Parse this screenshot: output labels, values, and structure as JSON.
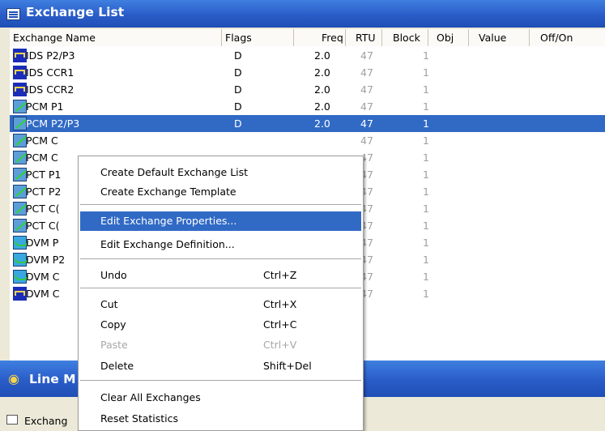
{
  "title": "Exchange List",
  "columns": [
    "Exchange Name",
    "Flags",
    "Freq",
    "RTU",
    "Block",
    "Obj",
    "Value",
    "Off/On"
  ],
  "rows": [
    {
      "icon": "ids-icon",
      "name": "IDS P2/P3",
      "flags": "D",
      "freq": "2.0",
      "rtu": "47",
      "block": "1"
    },
    {
      "icon": "ids-icon",
      "name": "IDS CCR1",
      "flags": "D",
      "freq": "2.0",
      "rtu": "47",
      "block": "1"
    },
    {
      "icon": "ids-icon",
      "name": "IDS CCR2",
      "flags": "D",
      "freq": "2.0",
      "rtu": "47",
      "block": "1"
    },
    {
      "icon": "pcm-icon",
      "name": "PCM P1",
      "flags": "D",
      "freq": "2.0",
      "rtu": "47",
      "block": "1"
    },
    {
      "icon": "pcm-icon",
      "name": "PCM P2/P3",
      "flags": "D",
      "freq": "2.0",
      "rtu": "47",
      "block": "1",
      "selected": true
    },
    {
      "icon": "pcm-icon",
      "name": "PCM C",
      "flags": "",
      "freq": "",
      "rtu": "47",
      "block": "1"
    },
    {
      "icon": "pcm-icon",
      "name": "PCM C",
      "flags": "",
      "freq": "",
      "rtu": "47",
      "block": "1"
    },
    {
      "icon": "pcm-icon",
      "name": "PCT P1",
      "flags": "",
      "freq": "",
      "rtu": "47",
      "block": "1"
    },
    {
      "icon": "pcm-icon",
      "name": "PCT P2",
      "flags": "",
      "freq": "",
      "rtu": "47",
      "block": "1"
    },
    {
      "icon": "pcm-icon",
      "name": "PCT C(",
      "flags": "",
      "freq": "",
      "rtu": "47",
      "block": "1"
    },
    {
      "icon": "pcm-icon",
      "name": "PCT C(",
      "flags": "",
      "freq": "",
      "rtu": "47",
      "block": "1"
    },
    {
      "icon": "dvm-icon",
      "name": "DVM P",
      "flags": "",
      "freq": "",
      "rtu": "47",
      "block": "1"
    },
    {
      "icon": "dvm-icon",
      "name": "DVM P2",
      "flags": "",
      "freq": "",
      "rtu": "47",
      "block": "1"
    },
    {
      "icon": "dvm-icon",
      "name": "DVM C",
      "flags": "",
      "freq": "",
      "rtu": "47",
      "block": "1"
    },
    {
      "icon": "ids-icon",
      "name": "DVM C",
      "flags": "",
      "freq": "",
      "rtu": "47",
      "block": "1"
    }
  ],
  "line_panel": {
    "title": "Line M"
  },
  "bottom_panel": {
    "label": "Exchang"
  },
  "context_menu": {
    "items": [
      {
        "label": "Create Default Exchange List",
        "shortcut": ""
      },
      {
        "label": "Create Exchange Template",
        "shortcut": ""
      },
      {
        "label": "Edit Exchange Properties...",
        "shortcut": "",
        "highlighted": true
      },
      {
        "label": "Edit Exchange Definition...",
        "shortcut": ""
      },
      {
        "label": "Undo",
        "shortcut": "Ctrl+Z"
      },
      {
        "label": "Cut",
        "shortcut": "Ctrl+X"
      },
      {
        "label": "Copy",
        "shortcut": "Ctrl+C"
      },
      {
        "label": "Paste",
        "shortcut": "Ctrl+V",
        "disabled": true
      },
      {
        "label": "Delete",
        "shortcut": "Shift+Del"
      },
      {
        "label": "Clear All Exchanges",
        "shortcut": ""
      },
      {
        "label": "Reset Statistics",
        "shortcut": ""
      }
    ]
  },
  "colors": {
    "titlebar": "#2a5cc8",
    "selection": "#316ac5",
    "menu_bg": "#ffffff"
  }
}
